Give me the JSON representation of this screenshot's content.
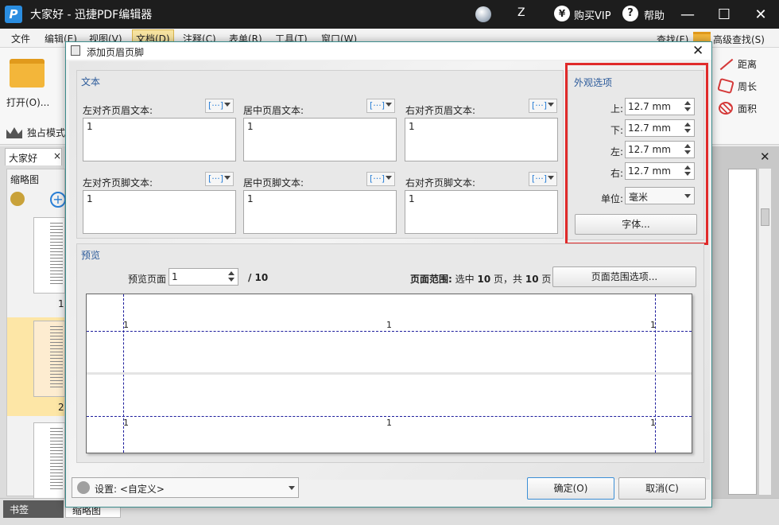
{
  "app": {
    "title": "大家好 - 迅捷PDF编辑器",
    "logo_letter": "P",
    "user_initial": "Z",
    "vip_icon": "¥",
    "vip_label": "购买VIP",
    "help_icon": "?",
    "help_label": "帮助",
    "minimize": "—",
    "maximize": "☐",
    "close": "✕"
  },
  "menu": [
    "文件",
    "编辑(E)",
    "视图(V)",
    "文档(D)",
    "注释(C)",
    "表单(R)",
    "工具(T)",
    "窗口(W)"
  ],
  "ribbon": {
    "open_label": "打开(O)...",
    "find_label": "查找(F)",
    "adv_find_label": "高级查找(S)",
    "distance_label": "距离",
    "perimeter_label": "周长",
    "area_label": "面积",
    "solo_label": "独占模式"
  },
  "doc": {
    "tab_label": "大家好",
    "tab_close": "×",
    "thumb_title": "缩略图",
    "page_numbers": [
      "1",
      "2"
    ]
  },
  "bottom_tabs": [
    "书签",
    "缩略图"
  ],
  "dialog": {
    "title": "添加页眉页脚",
    "close": "✕",
    "text_group": "文本",
    "macro_symbol": "[···]",
    "fields": [
      {
        "label": "左对齐页眉文本:",
        "value": "1"
      },
      {
        "label": "居中页眉文本:",
        "value": "1"
      },
      {
        "label": "右对齐页眉文本:",
        "value": "1"
      },
      {
        "label": "左对齐页脚文本:",
        "value": "1"
      },
      {
        "label": "居中页脚文本:",
        "value": "1"
      },
      {
        "label": "右对齐页脚文本:",
        "value": "1"
      }
    ],
    "appearance": {
      "title": "外观选项",
      "top_label": "上:",
      "top_value": "12.7 mm",
      "bottom_label": "下:",
      "bottom_value": "12.7 mm",
      "left_label": "左:",
      "left_value": "12.7 mm",
      "right_label": "右:",
      "right_value": "12.7 mm",
      "unit_label": "单位:",
      "unit_value": "毫米",
      "font_button": "字体..."
    },
    "preview": {
      "title": "预览",
      "page_label": "预览页面",
      "page_value": "1",
      "page_total": "/ 10",
      "range_prefix": "页面范围:",
      "range_mid": "选中",
      "range_selected": "10",
      "range_suffix1": "页，共",
      "range_total": "10",
      "range_suffix2": "页",
      "range_button": "页面范围选项...",
      "header_left": "1",
      "header_center": "1",
      "header_right": "1",
      "footer_left": "1",
      "footer_center": "1",
      "footer_right": "1"
    },
    "settings_label": "设置:",
    "settings_value": "<自定义>",
    "ok_button": "确定(O)",
    "cancel_button": "取消(C)"
  }
}
